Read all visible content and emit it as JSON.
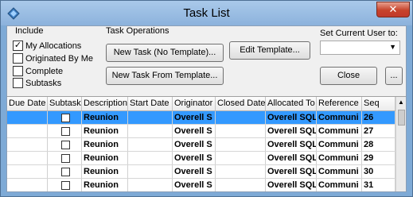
{
  "window": {
    "title": "Task List",
    "close_label": "✕"
  },
  "include": {
    "label": "Include",
    "items": [
      {
        "label": "My Allocations",
        "checked": "✓"
      },
      {
        "label": "Originated By Me",
        "checked": ""
      },
      {
        "label": "Complete",
        "checked": ""
      },
      {
        "label": "Subtasks",
        "checked": ""
      }
    ]
  },
  "task_ops": {
    "label": "Task Operations",
    "new_task_label": "New Task (No Template)...",
    "edit_template_label": "Edit Template...",
    "new_from_template_label": "New Task From Template..."
  },
  "current_user": {
    "label": "Set Current User to:",
    "value": ""
  },
  "buttons": {
    "close_label": "Close",
    "more_label": "..."
  },
  "grid": {
    "columns": [
      "Due Date",
      "Subtask",
      "Description",
      "Start Date",
      "Originator",
      "Closed Date",
      "Allocated To",
      "Reference",
      "Seq"
    ],
    "rows": [
      {
        "description": "Reunion",
        "originator": "Overell S",
        "allocated": "Overell SQL",
        "reference": "Communi",
        "seq": "26"
      },
      {
        "description": "Reunion",
        "originator": "Overell S",
        "allocated": "Overell SQL",
        "reference": "Communi",
        "seq": "27"
      },
      {
        "description": "Reunion",
        "originator": "Overell S",
        "allocated": "Overell SQL",
        "reference": "Communi",
        "seq": "28"
      },
      {
        "description": "Reunion",
        "originator": "Overell S",
        "allocated": "Overell SQL",
        "reference": "Communi",
        "seq": "29"
      },
      {
        "description": "Reunion",
        "originator": "Overell S",
        "allocated": "Overell SQL",
        "reference": "Communi",
        "seq": "30"
      },
      {
        "description": "Reunion",
        "originator": "Overell S",
        "allocated": "Overell SQL",
        "reference": "Communi",
        "seq": "31"
      }
    ]
  },
  "colors": {
    "selected_row": "#3399ff",
    "title_bar": "#8cb2dc"
  }
}
